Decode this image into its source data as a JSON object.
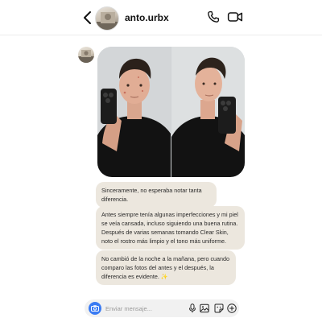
{
  "header": {
    "username": "anto.urbx"
  },
  "messages": [
    {
      "text": "Sinceramente, no esperaba notar tanta diferencia."
    },
    {
      "text": "Antes siempre tenía algunas imperfecciones y mi piel se veía cansada, incluso siguiendo una buena rutina. Después de varias semanas tomando Clear Skin, noto el rostro más limpio y el tono más uniforme."
    },
    {
      "text": "No cambió de la noche a la mañana, pero cuando comparo las fotos del antes y el después, la diferencia es evidente. ✨"
    }
  ],
  "composer": {
    "placeholder": "Enviar mensaje..."
  },
  "icons": {
    "back": "chevron-left-icon",
    "call": "phone-icon",
    "video": "video-camera-icon",
    "camera": "camera-icon",
    "mic": "microphone-icon",
    "gallery": "image-icon",
    "sticker": "sticker-icon",
    "plus": "plus-circle-icon"
  },
  "colors": {
    "bubble": "#ece7de",
    "camera_button": "#3a7bf3",
    "composer_bg": "#f1f1f1"
  }
}
